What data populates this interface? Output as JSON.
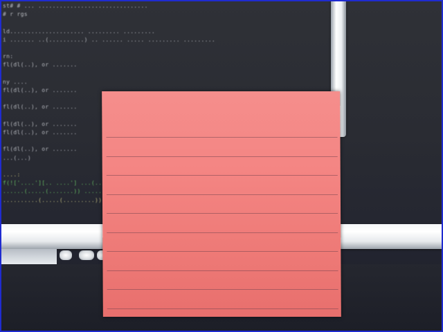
{
  "terminal": {
    "lines": [
      {
        "text": "st# # ... ...............................",
        "style": ""
      },
      {
        "text": "# r rgs",
        "style": ""
      },
      {
        "text": "",
        "style": ""
      },
      {
        "text": "ld..................... ......... .........",
        "style": ""
      },
      {
        "text": "i ....... ..(..........) .. ...... ..... ......... .........",
        "style": ""
      },
      {
        "text": "",
        "style": ""
      },
      {
        "text": "rn:",
        "style": ""
      },
      {
        "text": "fl(dl(..), or .......",
        "style": ""
      },
      {
        "text": "",
        "style": ""
      },
      {
        "text": "ny ....",
        "style": ""
      },
      {
        "text": "fl(dl(..), or .......",
        "style": ""
      },
      {
        "text": "",
        "style": ""
      },
      {
        "text": "fl(dl(..), or .......",
        "style": ""
      },
      {
        "text": "",
        "style": ""
      },
      {
        "text": "fl(dl(..), or .......",
        "style": ""
      },
      {
        "text": "fl(dl(..), or .......",
        "style": ""
      },
      {
        "text": "",
        "style": ""
      },
      {
        "text": "fl(dl(..), or .......",
        "style": ""
      },
      {
        "text": "...(...)",
        "style": ""
      },
      {
        "text": "",
        "style": ""
      },
      {
        "text": "....:",
        "style": "yellow"
      },
      {
        "text": "f(!['....'][.. ....'] ...(......",
        "style": "green"
      },
      {
        "text": "......(.....(.......)) .......(",
        "style": "green"
      },
      {
        "text": "..........(.....(.........)))",
        "style": "yellow"
      }
    ]
  },
  "sticky_note": {
    "color": "#f48583",
    "rule_count": 10
  },
  "dock": {
    "icons": [
      "dock-icon-1",
      "dock-icon-2",
      "dock-icon-3"
    ]
  }
}
